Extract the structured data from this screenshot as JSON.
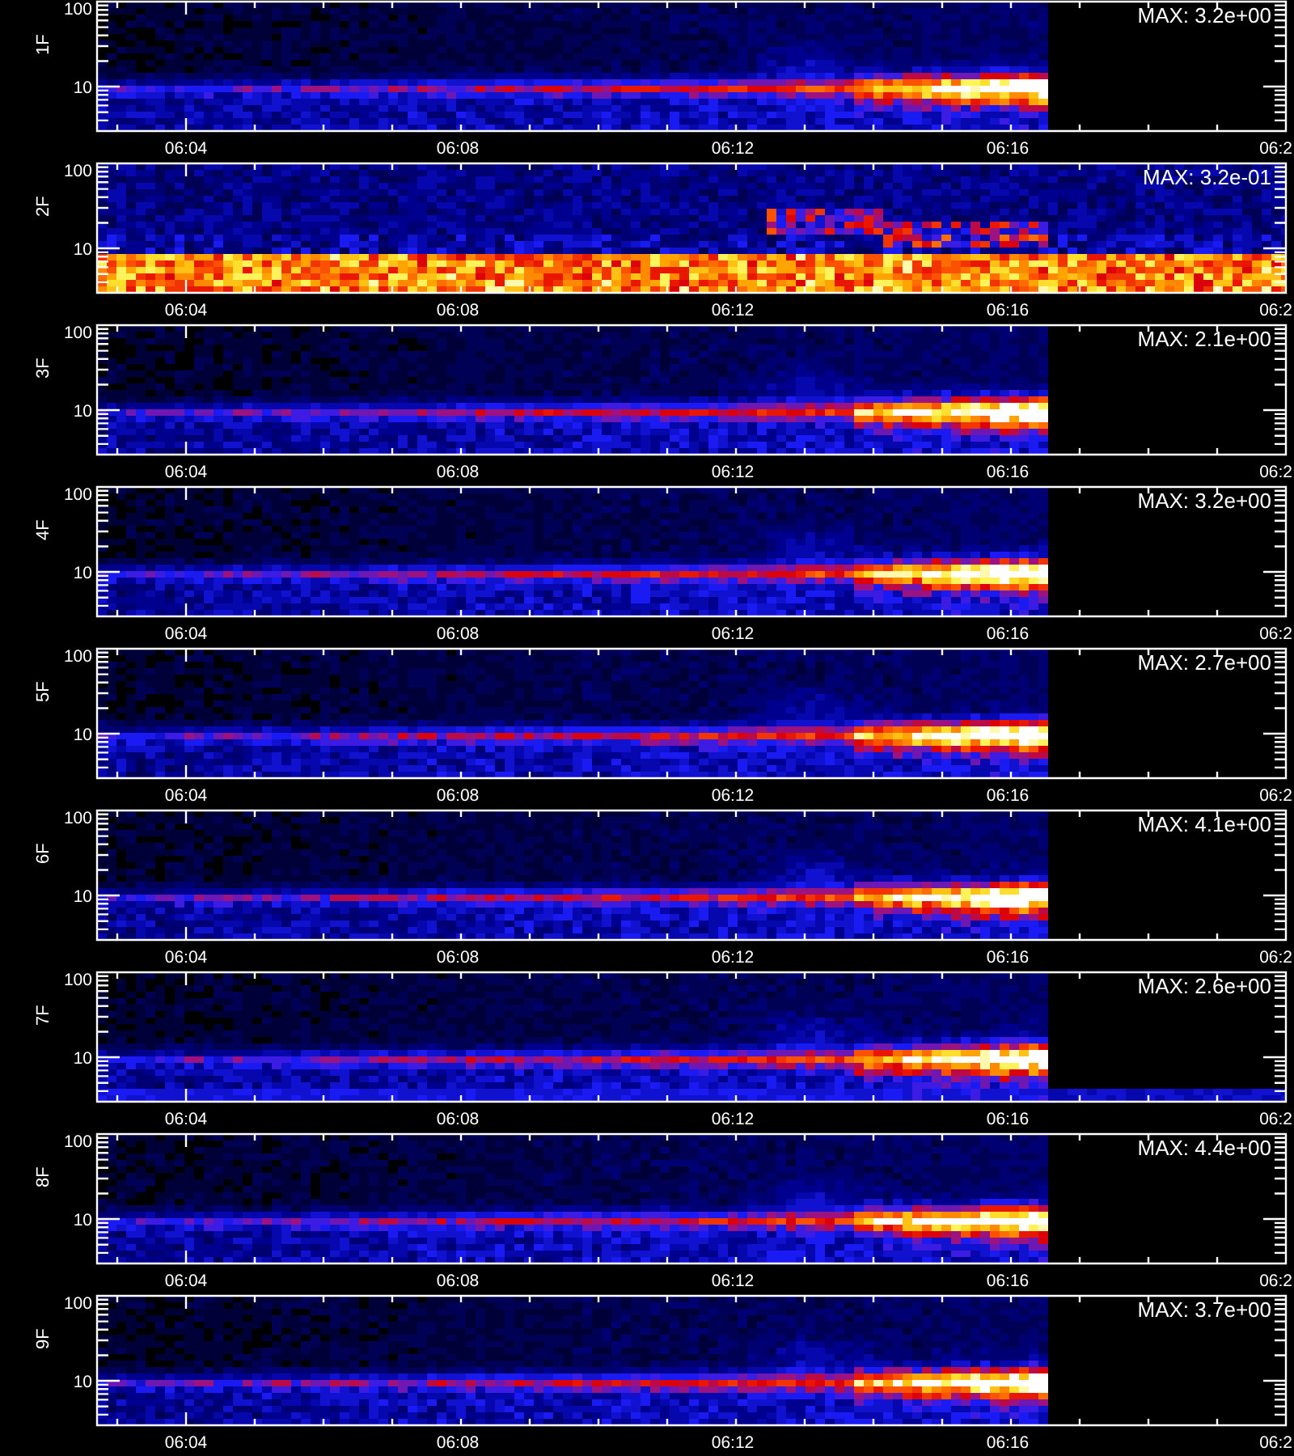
{
  "panels": [
    {
      "label": "1F",
      "max": "MAX: 3.2e+00",
      "kind": "normal",
      "y_ticks": [
        "100",
        "10"
      ],
      "x_ticks": [
        "06:04",
        "06:08",
        "06:12",
        "06:16",
        "06:2"
      ]
    },
    {
      "label": "2F",
      "max": "MAX: 3.2e-01",
      "kind": "noisy",
      "y_ticks": [
        "100",
        "10"
      ],
      "x_ticks": [
        "06:04",
        "06:08",
        "06:12",
        "06:16",
        "06:2"
      ]
    },
    {
      "label": "3F",
      "max": "MAX: 2.1e+00",
      "kind": "normal",
      "y_ticks": [
        "100",
        "10"
      ],
      "x_ticks": [
        "06:04",
        "06:08",
        "06:12",
        "06:16",
        "06:2"
      ]
    },
    {
      "label": "4F",
      "max": "MAX: 3.2e+00",
      "kind": "normal",
      "y_ticks": [
        "100",
        "10"
      ],
      "x_ticks": [
        "06:04",
        "06:08",
        "06:12",
        "06:16",
        "06:2"
      ]
    },
    {
      "label": "5F",
      "max": "MAX: 2.7e+00",
      "kind": "normal",
      "y_ticks": [
        "100",
        "10"
      ],
      "x_ticks": [
        "06:04",
        "06:08",
        "06:12",
        "06:16",
        "06:2"
      ]
    },
    {
      "label": "6F",
      "max": "MAX: 4.1e+00",
      "kind": "normal",
      "y_ticks": [
        "100",
        "10"
      ],
      "x_ticks": [
        "06:04",
        "06:08",
        "06:12",
        "06:16",
        "06:2"
      ]
    },
    {
      "label": "7F",
      "max": "MAX: 2.6e+00",
      "kind": "banded",
      "y_ticks": [
        "100",
        "10"
      ],
      "x_ticks": [
        "06:04",
        "06:08",
        "06:12",
        "06:16",
        "06:2"
      ]
    },
    {
      "label": "8F",
      "max": "MAX: 4.4e+00",
      "kind": "normal",
      "y_ticks": [
        "100",
        "10"
      ],
      "x_ticks": [
        "06:04",
        "06:08",
        "06:12",
        "06:16",
        "06:2"
      ]
    },
    {
      "label": "9F",
      "max": "MAX: 3.7e+00",
      "kind": "normal",
      "y_ticks": [
        "100",
        "10"
      ],
      "x_ticks": [
        "06:04",
        "06:08",
        "06:12",
        "06:16",
        "06:2"
      ]
    }
  ]
}
